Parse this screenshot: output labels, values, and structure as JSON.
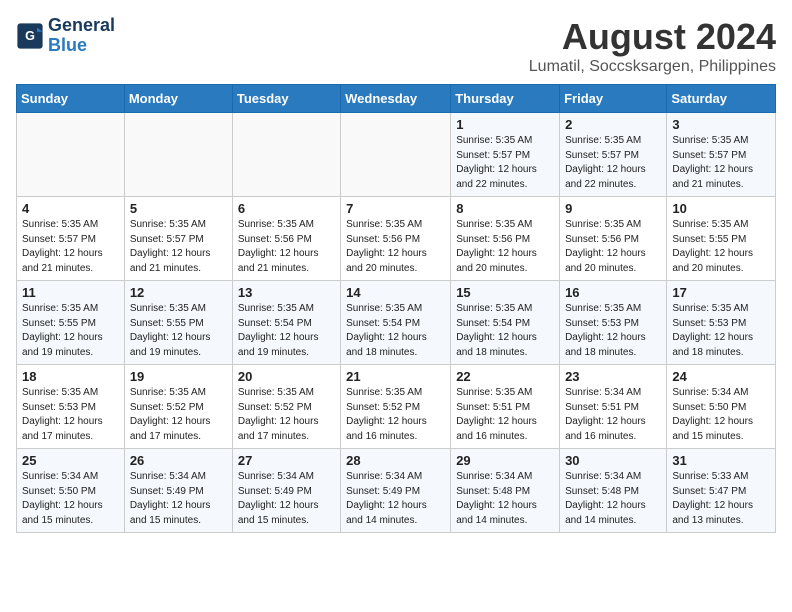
{
  "header": {
    "logo_line1": "General",
    "logo_line2": "Blue",
    "month_year": "August 2024",
    "location": "Lumatil, Soccsksargen, Philippines"
  },
  "weekdays": [
    "Sunday",
    "Monday",
    "Tuesday",
    "Wednesday",
    "Thursday",
    "Friday",
    "Saturday"
  ],
  "weeks": [
    [
      {
        "day": "",
        "info": ""
      },
      {
        "day": "",
        "info": ""
      },
      {
        "day": "",
        "info": ""
      },
      {
        "day": "",
        "info": ""
      },
      {
        "day": "1",
        "info": "Sunrise: 5:35 AM\nSunset: 5:57 PM\nDaylight: 12 hours\nand 22 minutes."
      },
      {
        "day": "2",
        "info": "Sunrise: 5:35 AM\nSunset: 5:57 PM\nDaylight: 12 hours\nand 22 minutes."
      },
      {
        "day": "3",
        "info": "Sunrise: 5:35 AM\nSunset: 5:57 PM\nDaylight: 12 hours\nand 21 minutes."
      }
    ],
    [
      {
        "day": "4",
        "info": "Sunrise: 5:35 AM\nSunset: 5:57 PM\nDaylight: 12 hours\nand 21 minutes."
      },
      {
        "day": "5",
        "info": "Sunrise: 5:35 AM\nSunset: 5:57 PM\nDaylight: 12 hours\nand 21 minutes."
      },
      {
        "day": "6",
        "info": "Sunrise: 5:35 AM\nSunset: 5:56 PM\nDaylight: 12 hours\nand 21 minutes."
      },
      {
        "day": "7",
        "info": "Sunrise: 5:35 AM\nSunset: 5:56 PM\nDaylight: 12 hours\nand 20 minutes."
      },
      {
        "day": "8",
        "info": "Sunrise: 5:35 AM\nSunset: 5:56 PM\nDaylight: 12 hours\nand 20 minutes."
      },
      {
        "day": "9",
        "info": "Sunrise: 5:35 AM\nSunset: 5:56 PM\nDaylight: 12 hours\nand 20 minutes."
      },
      {
        "day": "10",
        "info": "Sunrise: 5:35 AM\nSunset: 5:55 PM\nDaylight: 12 hours\nand 20 minutes."
      }
    ],
    [
      {
        "day": "11",
        "info": "Sunrise: 5:35 AM\nSunset: 5:55 PM\nDaylight: 12 hours\nand 19 minutes."
      },
      {
        "day": "12",
        "info": "Sunrise: 5:35 AM\nSunset: 5:55 PM\nDaylight: 12 hours\nand 19 minutes."
      },
      {
        "day": "13",
        "info": "Sunrise: 5:35 AM\nSunset: 5:54 PM\nDaylight: 12 hours\nand 19 minutes."
      },
      {
        "day": "14",
        "info": "Sunrise: 5:35 AM\nSunset: 5:54 PM\nDaylight: 12 hours\nand 18 minutes."
      },
      {
        "day": "15",
        "info": "Sunrise: 5:35 AM\nSunset: 5:54 PM\nDaylight: 12 hours\nand 18 minutes."
      },
      {
        "day": "16",
        "info": "Sunrise: 5:35 AM\nSunset: 5:53 PM\nDaylight: 12 hours\nand 18 minutes."
      },
      {
        "day": "17",
        "info": "Sunrise: 5:35 AM\nSunset: 5:53 PM\nDaylight: 12 hours\nand 18 minutes."
      }
    ],
    [
      {
        "day": "18",
        "info": "Sunrise: 5:35 AM\nSunset: 5:53 PM\nDaylight: 12 hours\nand 17 minutes."
      },
      {
        "day": "19",
        "info": "Sunrise: 5:35 AM\nSunset: 5:52 PM\nDaylight: 12 hours\nand 17 minutes."
      },
      {
        "day": "20",
        "info": "Sunrise: 5:35 AM\nSunset: 5:52 PM\nDaylight: 12 hours\nand 17 minutes."
      },
      {
        "day": "21",
        "info": "Sunrise: 5:35 AM\nSunset: 5:52 PM\nDaylight: 12 hours\nand 16 minutes."
      },
      {
        "day": "22",
        "info": "Sunrise: 5:35 AM\nSunset: 5:51 PM\nDaylight: 12 hours\nand 16 minutes."
      },
      {
        "day": "23",
        "info": "Sunrise: 5:34 AM\nSunset: 5:51 PM\nDaylight: 12 hours\nand 16 minutes."
      },
      {
        "day": "24",
        "info": "Sunrise: 5:34 AM\nSunset: 5:50 PM\nDaylight: 12 hours\nand 15 minutes."
      }
    ],
    [
      {
        "day": "25",
        "info": "Sunrise: 5:34 AM\nSunset: 5:50 PM\nDaylight: 12 hours\nand 15 minutes."
      },
      {
        "day": "26",
        "info": "Sunrise: 5:34 AM\nSunset: 5:49 PM\nDaylight: 12 hours\nand 15 minutes."
      },
      {
        "day": "27",
        "info": "Sunrise: 5:34 AM\nSunset: 5:49 PM\nDaylight: 12 hours\nand 15 minutes."
      },
      {
        "day": "28",
        "info": "Sunrise: 5:34 AM\nSunset: 5:49 PM\nDaylight: 12 hours\nand 14 minutes."
      },
      {
        "day": "29",
        "info": "Sunrise: 5:34 AM\nSunset: 5:48 PM\nDaylight: 12 hours\nand 14 minutes."
      },
      {
        "day": "30",
        "info": "Sunrise: 5:34 AM\nSunset: 5:48 PM\nDaylight: 12 hours\nand 14 minutes."
      },
      {
        "day": "31",
        "info": "Sunrise: 5:33 AM\nSunset: 5:47 PM\nDaylight: 12 hours\nand 13 minutes."
      }
    ]
  ]
}
